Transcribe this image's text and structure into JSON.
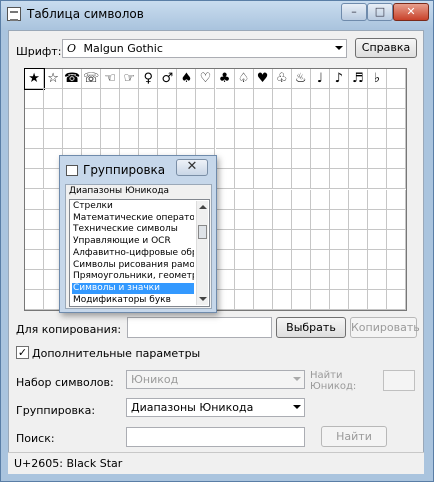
{
  "window": {
    "title": "Таблица символов",
    "min": "–",
    "max": "□",
    "close": "✕"
  },
  "font": {
    "label": "Шрифт:",
    "glyph": "O",
    "value": "Malgun Gothic",
    "help_button": "Справка"
  },
  "grid": {
    "first_row": [
      "★",
      "☆",
      "☎",
      "☏",
      "☜",
      "☞",
      "♀",
      "♂",
      "♠",
      "♡",
      "♣",
      "♤",
      "♥",
      "♧",
      "♨",
      "♩",
      "♪",
      "♬",
      "♭"
    ],
    "selected_index": 0
  },
  "copy": {
    "label": "Для копирования:",
    "value": "",
    "select_button": "Выбрать",
    "copy_button": "Копировать"
  },
  "advanced": {
    "checkbox_label": "Дополнительные параметры",
    "checked": "✓"
  },
  "charset": {
    "label": "Набор символов:",
    "value": "Юникод",
    "goto_label_1": "Найти",
    "goto_label_2": "Юникод:"
  },
  "grouping": {
    "label": "Группировка:",
    "value": "Диапазоны Юникода"
  },
  "search": {
    "label": "Поиск:",
    "value": "",
    "find_button": "Найти"
  },
  "status": "U+2605: Black Star",
  "popup": {
    "title": "Группировка",
    "close": "✕",
    "header": "Диапазоны Юникода",
    "items": [
      "Стрелки",
      "Математические операторы",
      "Технические символы",
      "Управляющие и OCR",
      "Алфавитно-цифровые обр",
      "Символы рисования рамок",
      "Прямоугольники, геометри",
      "Символы и значки",
      "Модификаторы букв"
    ],
    "highlighted_index": 7
  }
}
